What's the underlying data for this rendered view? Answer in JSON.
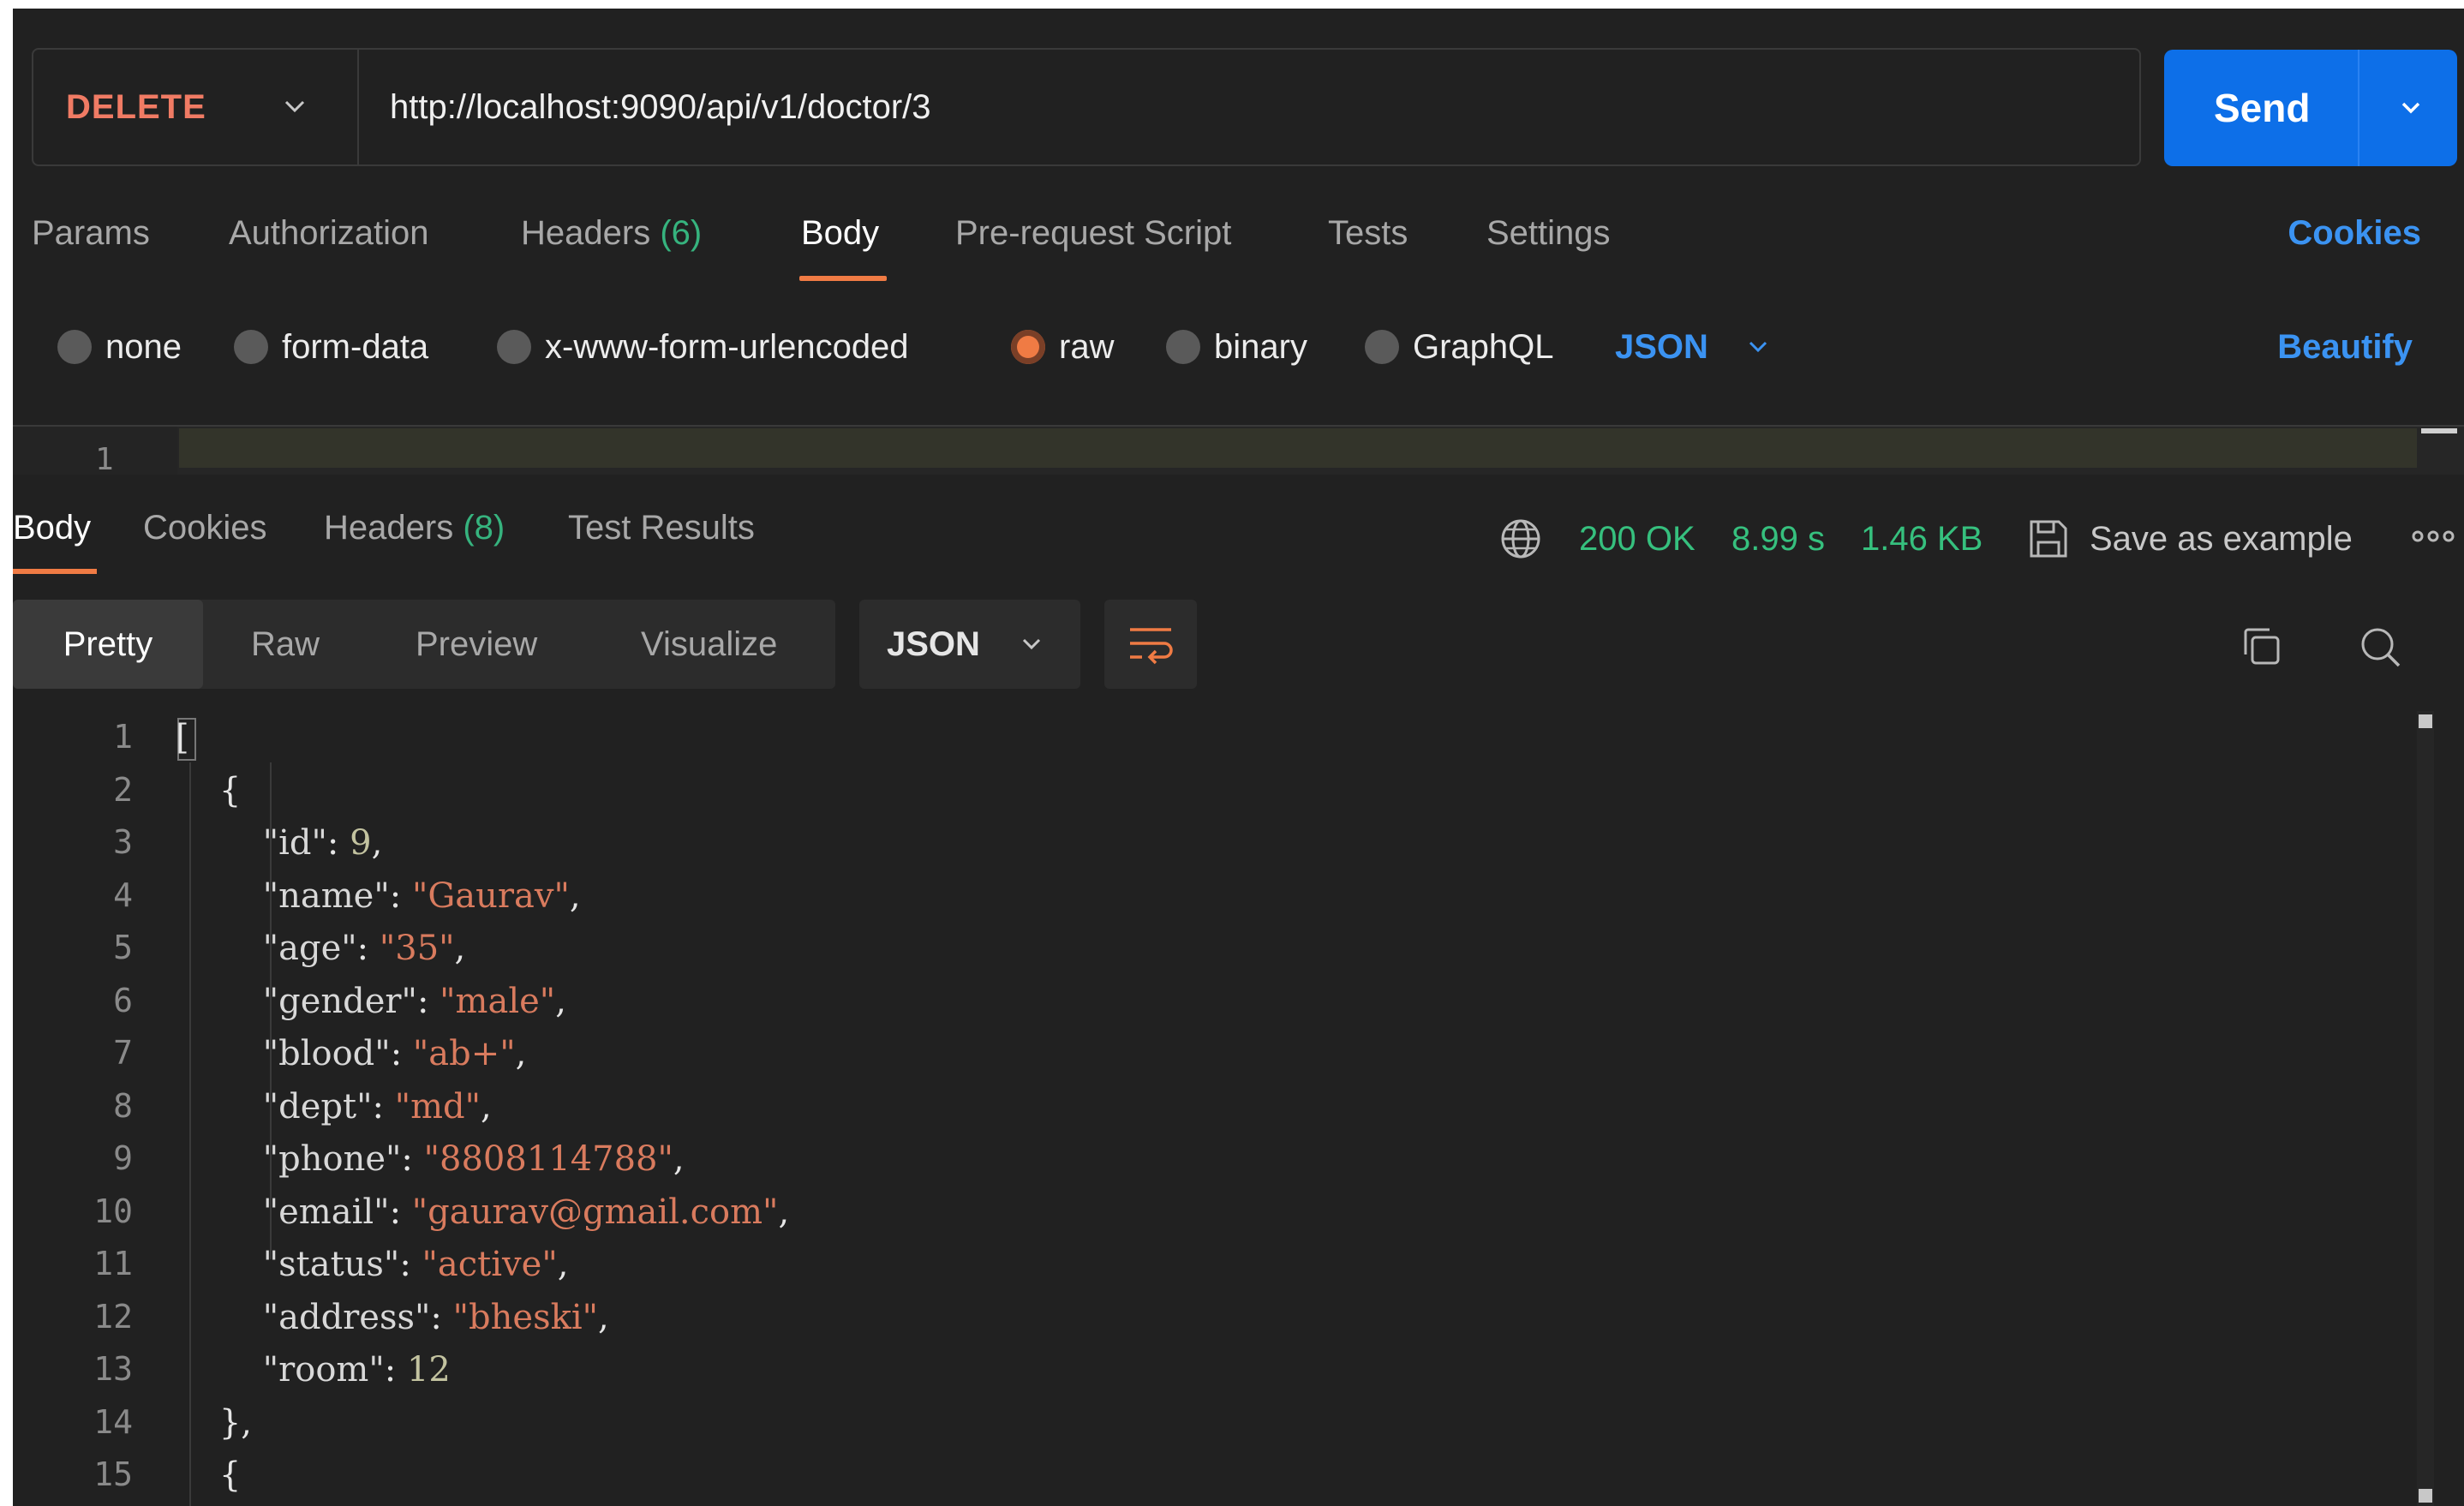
{
  "request": {
    "method": "DELETE",
    "url": "http://localhost:9090/api/v1/doctor/3",
    "send_label": "Send"
  },
  "request_tabs": {
    "params": "Params",
    "authorization": "Authorization",
    "headers": "Headers",
    "headers_count": "(6)",
    "body": "Body",
    "prerequest": "Pre-request Script",
    "tests": "Tests",
    "settings": "Settings",
    "cookies": "Cookies"
  },
  "body_types": {
    "none": "none",
    "form_data": "form-data",
    "urlencoded": "x-www-form-urlencoded",
    "raw": "raw",
    "binary": "binary",
    "graphql": "GraphQL",
    "selected": "raw",
    "language": "JSON",
    "beautify": "Beautify"
  },
  "request_editor": {
    "line": "1"
  },
  "response_tabs": {
    "body": "Body",
    "cookies": "Cookies",
    "headers": "Headers",
    "headers_count": "(8)",
    "test_results": "Test Results"
  },
  "response_meta": {
    "status": "200 OK",
    "time": "8.99 s",
    "size": "1.46 KB",
    "save_example": "Save as example"
  },
  "view_tabs": {
    "pretty": "Pretty",
    "raw": "Raw",
    "preview": "Preview",
    "visualize": "Visualize",
    "format": "JSON"
  },
  "colors": {
    "accent": "#f07b44",
    "link": "#3b93f2",
    "success": "#36c07e",
    "send": "#0d6fe8",
    "method": "#f07b64"
  },
  "response_lines": [
    {
      "n": "1",
      "tokens": [
        [
          "p",
          "["
        ]
      ]
    },
    {
      "n": "2",
      "tokens": [
        [
          "p",
          "    {"
        ]
      ]
    },
    {
      "n": "3",
      "tokens": [
        [
          "p",
          "        "
        ],
        [
          "k",
          "\"id\""
        ],
        [
          "p",
          ": "
        ],
        [
          "n",
          "9"
        ],
        [
          "p",
          ","
        ]
      ]
    },
    {
      "n": "4",
      "tokens": [
        [
          "p",
          "        "
        ],
        [
          "k",
          "\"name\""
        ],
        [
          "p",
          ": "
        ],
        [
          "s",
          "\"Gaurav\""
        ],
        [
          "p",
          ","
        ]
      ]
    },
    {
      "n": "5",
      "tokens": [
        [
          "p",
          "        "
        ],
        [
          "k",
          "\"age\""
        ],
        [
          "p",
          ": "
        ],
        [
          "s",
          "\"35\""
        ],
        [
          "p",
          ","
        ]
      ]
    },
    {
      "n": "6",
      "tokens": [
        [
          "p",
          "        "
        ],
        [
          "k",
          "\"gender\""
        ],
        [
          "p",
          ": "
        ],
        [
          "s",
          "\"male\""
        ],
        [
          "p",
          ","
        ]
      ]
    },
    {
      "n": "7",
      "tokens": [
        [
          "p",
          "        "
        ],
        [
          "k",
          "\"blood\""
        ],
        [
          "p",
          ": "
        ],
        [
          "s",
          "\"ab+\""
        ],
        [
          "p",
          ","
        ]
      ]
    },
    {
      "n": "8",
      "tokens": [
        [
          "p",
          "        "
        ],
        [
          "k",
          "\"dept\""
        ],
        [
          "p",
          ": "
        ],
        [
          "s",
          "\"md\""
        ],
        [
          "p",
          ","
        ]
      ]
    },
    {
      "n": "9",
      "tokens": [
        [
          "p",
          "        "
        ],
        [
          "k",
          "\"phone\""
        ],
        [
          "p",
          ": "
        ],
        [
          "s",
          "\"8808114788\""
        ],
        [
          "p",
          ","
        ]
      ]
    },
    {
      "n": "10",
      "tokens": [
        [
          "p",
          "        "
        ],
        [
          "k",
          "\"email\""
        ],
        [
          "p",
          ": "
        ],
        [
          "s",
          "\"gaurav@gmail.com\""
        ],
        [
          "p",
          ","
        ]
      ]
    },
    {
      "n": "11",
      "tokens": [
        [
          "p",
          "        "
        ],
        [
          "k",
          "\"status\""
        ],
        [
          "p",
          ": "
        ],
        [
          "s",
          "\"active\""
        ],
        [
          "p",
          ","
        ]
      ]
    },
    {
      "n": "12",
      "tokens": [
        [
          "p",
          "        "
        ],
        [
          "k",
          "\"address\""
        ],
        [
          "p",
          ": "
        ],
        [
          "s",
          "\"bheski\""
        ],
        [
          "p",
          ","
        ]
      ]
    },
    {
      "n": "13",
      "tokens": [
        [
          "p",
          "        "
        ],
        [
          "k",
          "\"room\""
        ],
        [
          "p",
          ": "
        ],
        [
          "n",
          "12"
        ]
      ]
    },
    {
      "n": "14",
      "tokens": [
        [
          "p",
          "    },"
        ]
      ]
    },
    {
      "n": "15",
      "tokens": [
        [
          "p",
          "    {"
        ]
      ]
    }
  ]
}
